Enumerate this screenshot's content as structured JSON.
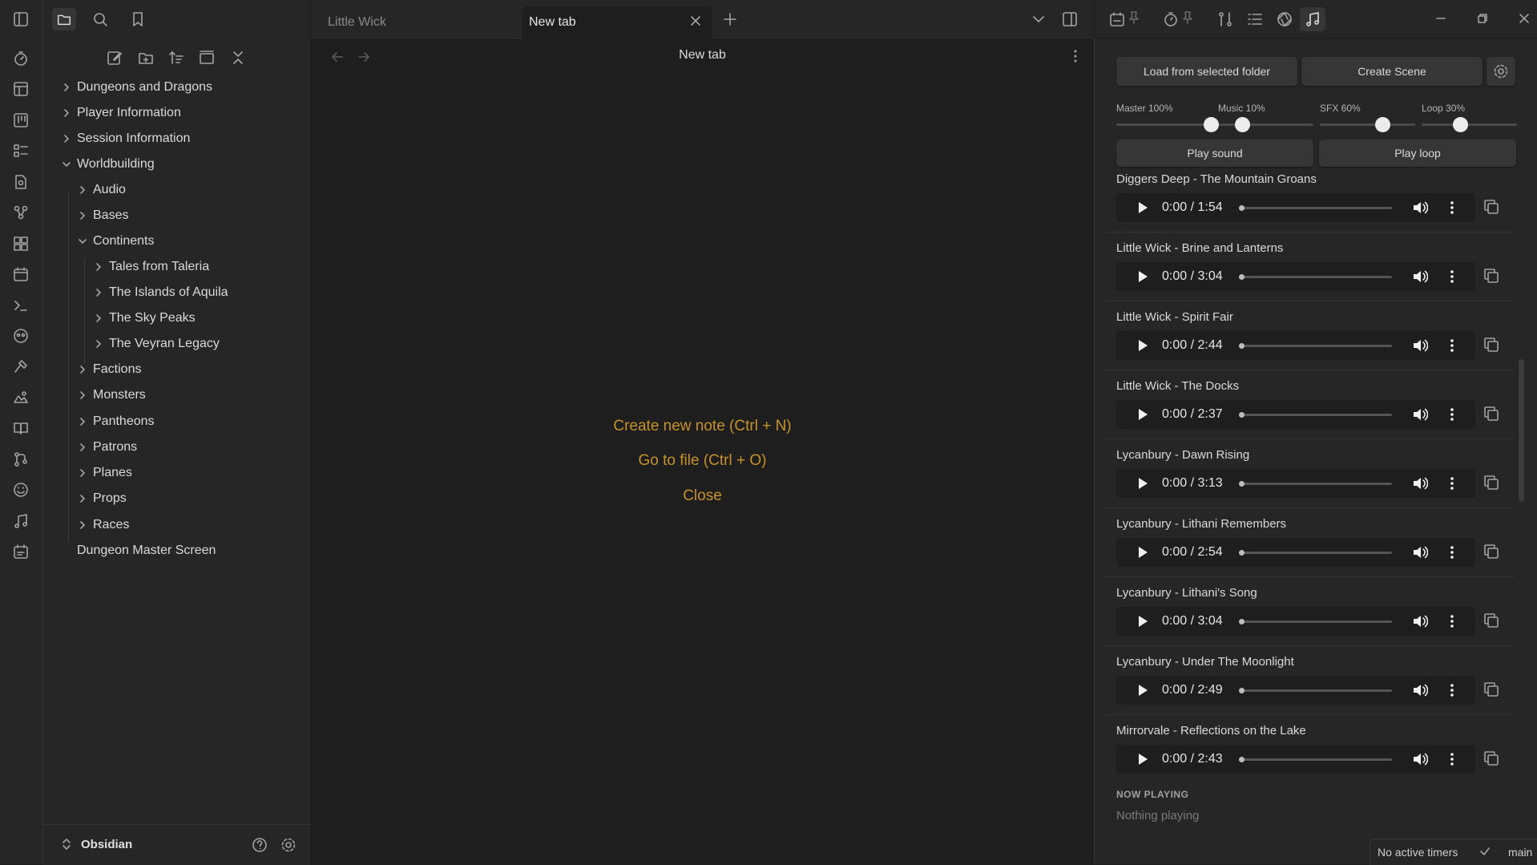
{
  "tabs": [
    {
      "label": "Little Wick"
    },
    {
      "label": "New tab"
    }
  ],
  "main": {
    "header_title": "New tab",
    "actions": [
      "Create new note (Ctrl + N)",
      "Go to file (Ctrl + O)",
      "Close"
    ]
  },
  "explorer": {
    "items": [
      {
        "label": "Dungeons and Dragons"
      },
      {
        "label": "Player Information"
      },
      {
        "label": "Session Information"
      },
      {
        "label": "Worldbuilding"
      },
      {
        "label": "Audio"
      },
      {
        "label": "Bases"
      },
      {
        "label": "Continents"
      },
      {
        "label": "Tales from Taleria"
      },
      {
        "label": "The Islands of Aquila"
      },
      {
        "label": "The Sky Peaks"
      },
      {
        "label": "The Veyran Legacy"
      },
      {
        "label": "Factions"
      },
      {
        "label": "Monsters"
      },
      {
        "label": "Pantheons"
      },
      {
        "label": "Patrons"
      },
      {
        "label": "Planes"
      },
      {
        "label": "Props"
      },
      {
        "label": "Races"
      },
      {
        "label": "Dungeon Master Screen"
      }
    ]
  },
  "vault": {
    "name": "Obsidian"
  },
  "soundboard": {
    "load_button": "Load from selected folder",
    "create_scene_button": "Create Scene",
    "volumes": [
      {
        "label": "Master 100%",
        "value": 100
      },
      {
        "label": "Music 10%",
        "value": 10
      },
      {
        "label": "SFX 60%",
        "value": 60
      },
      {
        "label": "Loop 30%",
        "value": 30
      }
    ],
    "play_sound_button": "Play sound",
    "play_loop_button": "Play loop",
    "tracks": [
      {
        "title": "Diggers Deep - The Mountain Groans",
        "time": "0:00 / 1:54"
      },
      {
        "title": "Little Wick - Brine and Lanterns",
        "time": "0:00 / 3:04"
      },
      {
        "title": "Little Wick - Spirit Fair",
        "time": "0:00 / 2:44"
      },
      {
        "title": "Little Wick - The Docks",
        "time": "0:00 / 2:37"
      },
      {
        "title": "Lycanbury - Dawn Rising",
        "time": "0:00 / 3:13"
      },
      {
        "title": "Lycanbury - Lithani Remembers",
        "time": "0:00 / 2:54"
      },
      {
        "title": "Lycanbury - Lithani's Song",
        "time": "0:00 / 3:04"
      },
      {
        "title": "Lycanbury - Under The Moonlight",
        "time": "0:00 / 2:49"
      },
      {
        "title": "Mirrorvale - Reflections on the Lake",
        "time": "0:00 / 2:43"
      }
    ],
    "now_playing_heading": "NOW PLAYING",
    "now_playing_text": "Nothing playing"
  },
  "status": {
    "timers": "No active timers",
    "branch": "main"
  },
  "colors": {
    "accent": "#c8922a",
    "background": "#1e1e1e",
    "panel": "#262626"
  }
}
